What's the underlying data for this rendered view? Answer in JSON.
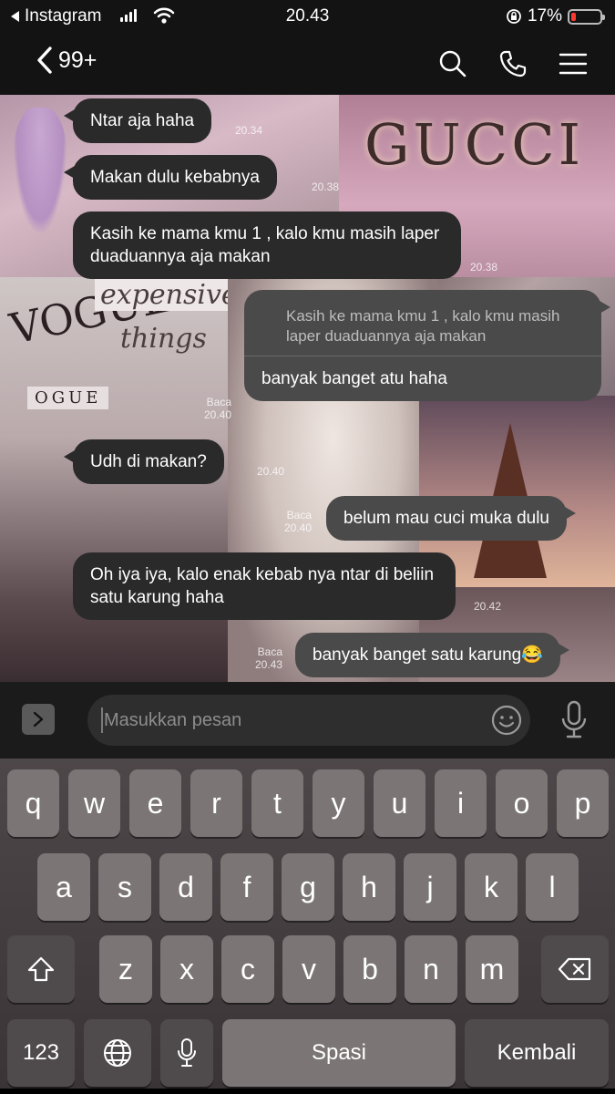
{
  "status": {
    "back_app": "Instagram",
    "time": "20.43",
    "battery": "17%",
    "battery_level": 0.17
  },
  "header": {
    "back_count": "99+"
  },
  "messages": [
    {
      "dir": "in",
      "text": "Ntar aja haha",
      "time": "20.34"
    },
    {
      "dir": "in",
      "text": "Makan dulu kebabnya",
      "time": "20.38"
    },
    {
      "dir": "in",
      "text": "Kasih ke mama kmu 1 , kalo kmu masih laper duaduannya aja makan",
      "time": "20.38"
    },
    {
      "dir": "out",
      "quote": "Kasih ke mama kmu 1 , kalo kmu masih laper duaduannya aja makan",
      "text": "banyak banget atu haha",
      "read": "Baca",
      "time": "20.40"
    },
    {
      "dir": "in",
      "text": "Udh di makan?",
      "time": "20.40"
    },
    {
      "dir": "out",
      "text": "belum mau cuci muka dulu",
      "read": "Baca",
      "time": "20.40"
    },
    {
      "dir": "in",
      "text": "Oh iya iya, kalo enak kebab nya ntar di beliin satu karung haha",
      "time": "20.42"
    },
    {
      "dir": "out",
      "text": "banyak banget satu karung😂",
      "read": "Baca",
      "time": "20.43"
    }
  ],
  "background": {
    "brand": "GUCCI",
    "magazine": "VOGUE",
    "magazine2": "OGUE",
    "caption1": "expensive",
    "caption2": "things"
  },
  "input": {
    "placeholder": "Masukkan pesan"
  },
  "keyboard": {
    "row1": [
      "q",
      "w",
      "e",
      "r",
      "t",
      "y",
      "u",
      "i",
      "o",
      "p"
    ],
    "row2": [
      "a",
      "s",
      "d",
      "f",
      "g",
      "h",
      "j",
      "k",
      "l"
    ],
    "row3": [
      "z",
      "x",
      "c",
      "v",
      "b",
      "n",
      "m"
    ],
    "numbers": "123",
    "space": "Spasi",
    "return": "Kembali"
  }
}
